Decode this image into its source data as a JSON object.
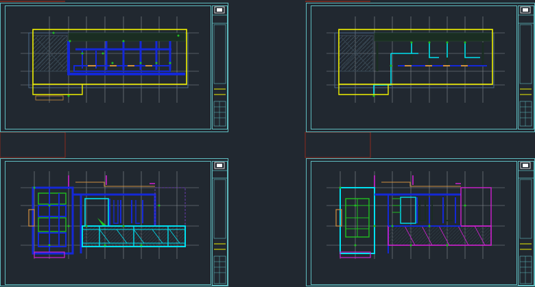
{
  "canvas": {
    "background": "#212830",
    "grid_color": "#8a9096",
    "frame_color": "#5fbcc0",
    "wall_color": "#1428d8",
    "hatch_color": "#3a4a56",
    "highlight_yellow": "#f0f000",
    "accent_cyan": "#00e0f0",
    "accent_green": "#20c020",
    "accent_magenta": "#d020d0",
    "accent_orange": "#d09040",
    "layout_tab_color": "#8a2a1e"
  },
  "sheets": [
    {
      "id": "top-left",
      "style": "yellow-highlight-blue-walls"
    },
    {
      "id": "top-right",
      "style": "yellow-highlight-cyan-pipes"
    },
    {
      "id": "bottom-left",
      "style": "blue-cyan-green-plan"
    },
    {
      "id": "bottom-right",
      "style": "cyan-green-magenta-plan"
    }
  ],
  "title_block_icon": "stamp-icon"
}
